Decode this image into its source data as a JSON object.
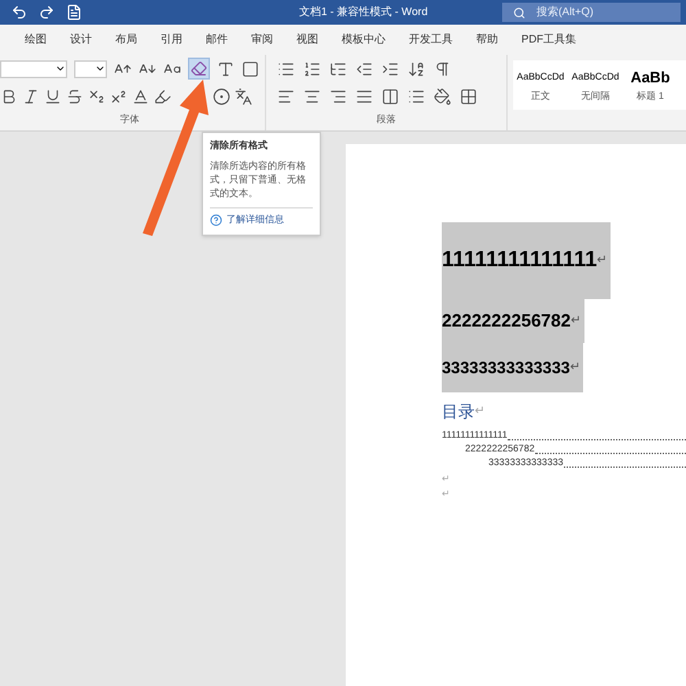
{
  "title_bar": {
    "title": "文档1 - 兼容性模式 - Word",
    "search": {
      "placeholder": "搜索(Alt+Q)"
    }
  },
  "menu_tabs": [
    "绘图",
    "设计",
    "布局",
    "引用",
    "邮件",
    "审阅",
    "视图",
    "模板中心",
    "开发工具",
    "帮助",
    "PDF工具集"
  ],
  "ribbon": {
    "clear_format_button": {
      "hovered": true
    },
    "groups": [
      "字体",
      "段落"
    ],
    "styles": [
      {
        "preview": "AaBbCcDd",
        "name": "正文",
        "kind": "normal"
      },
      {
        "preview": "AaBbCcDd",
        "name": "无间隔",
        "kind": "normal"
      },
      {
        "preview": "AaBb",
        "name": "标题 1",
        "kind": "heading"
      }
    ]
  },
  "tooltip": {
    "title": "清除所有格式",
    "body": "清除所选内容的所有格式，只留下普通、无格式的文本。",
    "link": "了解详细信息"
  },
  "document": {
    "headings": [
      {
        "text": "11111111111111",
        "selected": true
      },
      {
        "text": "2222222256782",
        "selected": true
      },
      {
        "text": "33333333333333",
        "selected": true
      }
    ],
    "toc_title": "目录",
    "toc": [
      {
        "text": "11111111111111",
        "children": [
          {
            "text": "2222222256782",
            "children": [
              {
                "text": "33333333333333"
              }
            ]
          }
        ]
      }
    ],
    "paragraph_mark": "↵"
  }
}
